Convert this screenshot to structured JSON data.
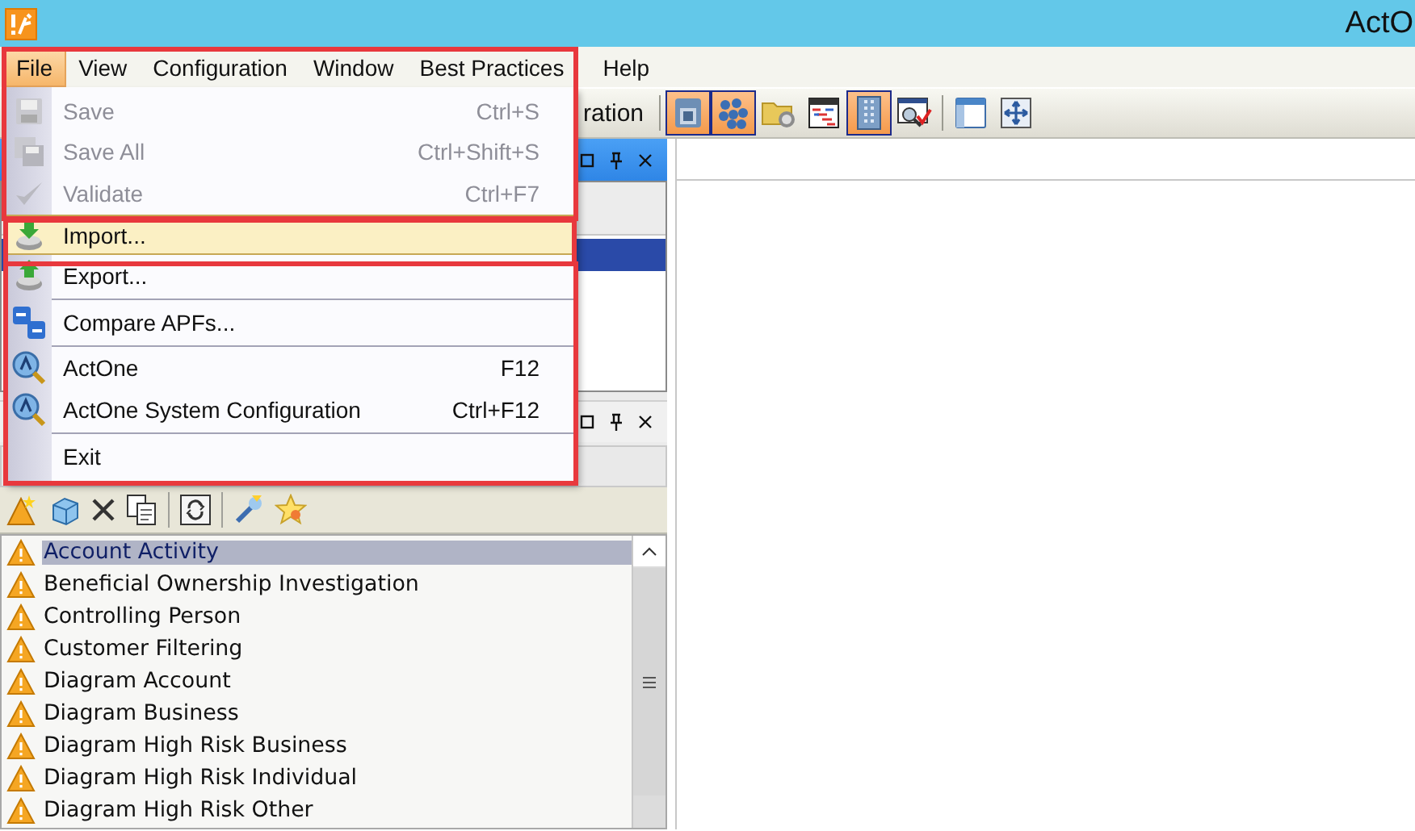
{
  "window": {
    "title": "ActO"
  },
  "menu_bar": [
    {
      "label": "File",
      "selected": true
    },
    {
      "label": "View",
      "selected": false
    },
    {
      "label": "Configuration",
      "selected": false
    },
    {
      "label": "Window",
      "selected": false
    },
    {
      "label": "Best Practices",
      "selected": false
    },
    {
      "label": "Help",
      "selected": false
    }
  ],
  "file_menu": {
    "items": [
      {
        "kind": "command",
        "label": "Save",
        "shortcut": "Ctrl+S",
        "disabled": true,
        "selected": false
      },
      {
        "kind": "command",
        "label": "Save All",
        "shortcut": "Ctrl+Shift+S",
        "disabled": true,
        "selected": false
      },
      {
        "kind": "command",
        "label": "Validate",
        "shortcut": "Ctrl+F7",
        "disabled": true,
        "selected": false
      },
      {
        "kind": "command",
        "label": "Import...",
        "disabled": false,
        "selected": true
      },
      {
        "kind": "command",
        "label": "Export...",
        "disabled": false,
        "selected": false
      },
      {
        "kind": "separator"
      },
      {
        "kind": "command",
        "label": "Compare APFs...",
        "disabled": false,
        "selected": false
      },
      {
        "kind": "separator"
      },
      {
        "kind": "command",
        "label": "ActOne",
        "shortcut": "F12",
        "disabled": false,
        "selected": false
      },
      {
        "kind": "command",
        "label": "ActOne System Configuration",
        "shortcut": "Ctrl+F12",
        "disabled": false,
        "selected": false
      },
      {
        "kind": "separator"
      },
      {
        "kind": "command",
        "label": "Exit",
        "disabled": false,
        "selected": false
      }
    ]
  },
  "toolbar": {
    "label": "ration",
    "buttons": [
      {
        "on": true
      },
      {
        "on": true
      },
      {
        "on": false
      },
      {
        "on": false
      },
      {
        "on": true
      },
      {
        "on": false
      },
      {
        "on": false
      },
      {
        "on": false
      }
    ]
  },
  "panels": [
    {
      "active": true,
      "rows": [
        {
          "selected": true
        }
      ]
    },
    {
      "active": false
    }
  ],
  "list": {
    "items": [
      {
        "label": "Account Activity",
        "selected": true
      },
      {
        "label": "Beneficial Ownership Investigation",
        "selected": false
      },
      {
        "label": "Controlling Person",
        "selected": false
      },
      {
        "label": "Customer Filtering",
        "selected": false
      },
      {
        "label": "Diagram Account",
        "selected": false
      },
      {
        "label": "Diagram Business",
        "selected": false
      },
      {
        "label": "Diagram High Risk Business",
        "selected": false
      },
      {
        "label": "Diagram High Risk Individual",
        "selected": false
      },
      {
        "label": "Diagram High Risk Other",
        "selected": false
      }
    ]
  }
}
